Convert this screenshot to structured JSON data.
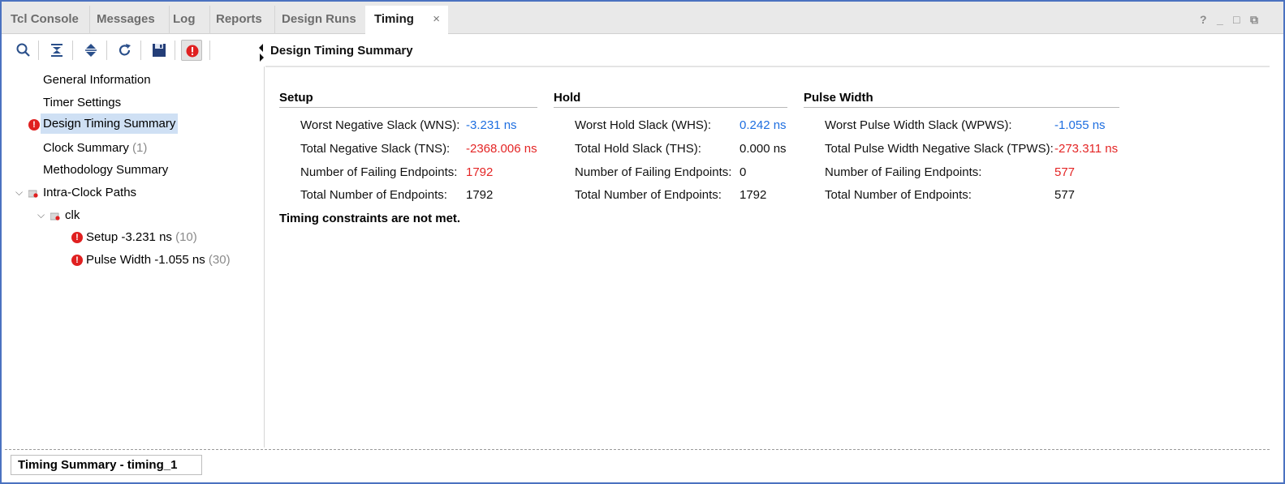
{
  "tabs": [
    {
      "label": "Tcl Console",
      "active": false
    },
    {
      "label": "Messages",
      "active": false
    },
    {
      "label": "Log",
      "active": false
    },
    {
      "label": "Reports",
      "active": false
    },
    {
      "label": "Design Runs",
      "active": false
    },
    {
      "label": "Timing",
      "active": true
    }
  ],
  "tab_close_glyph": "×",
  "window_controls": {
    "help": "?",
    "minimize": "_",
    "maximize": "□",
    "restore": "⧉"
  },
  "toolbar": {
    "icons": [
      "search-icon",
      "collapse-all-icon",
      "expand-all-icon",
      "refresh-icon",
      "save-icon",
      "error-filter-icon"
    ]
  },
  "tree": {
    "items": [
      {
        "label": "General Information",
        "count": ""
      },
      {
        "label": "Timer Settings",
        "count": ""
      },
      {
        "label": "Design Timing Summary",
        "count": "",
        "selected": true,
        "error": true
      },
      {
        "label": "Clock Summary",
        "count": "(1)"
      },
      {
        "label": "Methodology Summary",
        "count": ""
      },
      {
        "label": "Intra-Clock Paths",
        "count": "",
        "expanded": true
      },
      {
        "label": "clk",
        "count": "",
        "expanded": true
      },
      {
        "label": "Setup -3.231 ns",
        "count": "(10)",
        "error": true
      },
      {
        "label": "Pulse Width -1.055 ns",
        "count": "(30)",
        "error": true
      }
    ]
  },
  "panel": {
    "title": "Design Timing Summary",
    "setup": {
      "title": "Setup",
      "rows": [
        {
          "label": "Worst Negative Slack (WNS):",
          "value": "-3.231 ns",
          "color": "#1f6fe0"
        },
        {
          "label": "Total Negative Slack (TNS):",
          "value": "-2368.006 ns",
          "color": "#e42525"
        },
        {
          "label": "Number of Failing Endpoints:",
          "value": "1792",
          "color": "#e42525"
        },
        {
          "label": "Total Number of Endpoints:",
          "value": "1792",
          "color": "#111111"
        }
      ]
    },
    "hold": {
      "title": "Hold",
      "rows": [
        {
          "label": "Worst Hold Slack (WHS):",
          "value": "0.242 ns",
          "color": "#1f6fe0"
        },
        {
          "label": "Total Hold Slack (THS):",
          "value": "0.000 ns",
          "color": "#111111"
        },
        {
          "label": "Number of Failing Endpoints:",
          "value": "0",
          "color": "#111111"
        },
        {
          "label": "Total Number of Endpoints:",
          "value": "1792",
          "color": "#111111"
        }
      ]
    },
    "pulse": {
      "title": "Pulse Width",
      "rows": [
        {
          "label": "Worst Pulse Width Slack (WPWS):",
          "value": "-1.055 ns",
          "color": "#1f6fe0"
        },
        {
          "label": "Total Pulse Width Negative Slack (TPWS):",
          "value": "-273.311 ns",
          "color": "#e42525"
        },
        {
          "label": "Number of Failing Endpoints:",
          "value": "577",
          "color": "#e42525"
        },
        {
          "label": "Total Number of Endpoints:",
          "value": "577",
          "color": "#111111"
        }
      ]
    },
    "status_message": "Timing constraints are not met."
  },
  "bottom_tab": {
    "label": "Timing Summary - timing_1"
  }
}
